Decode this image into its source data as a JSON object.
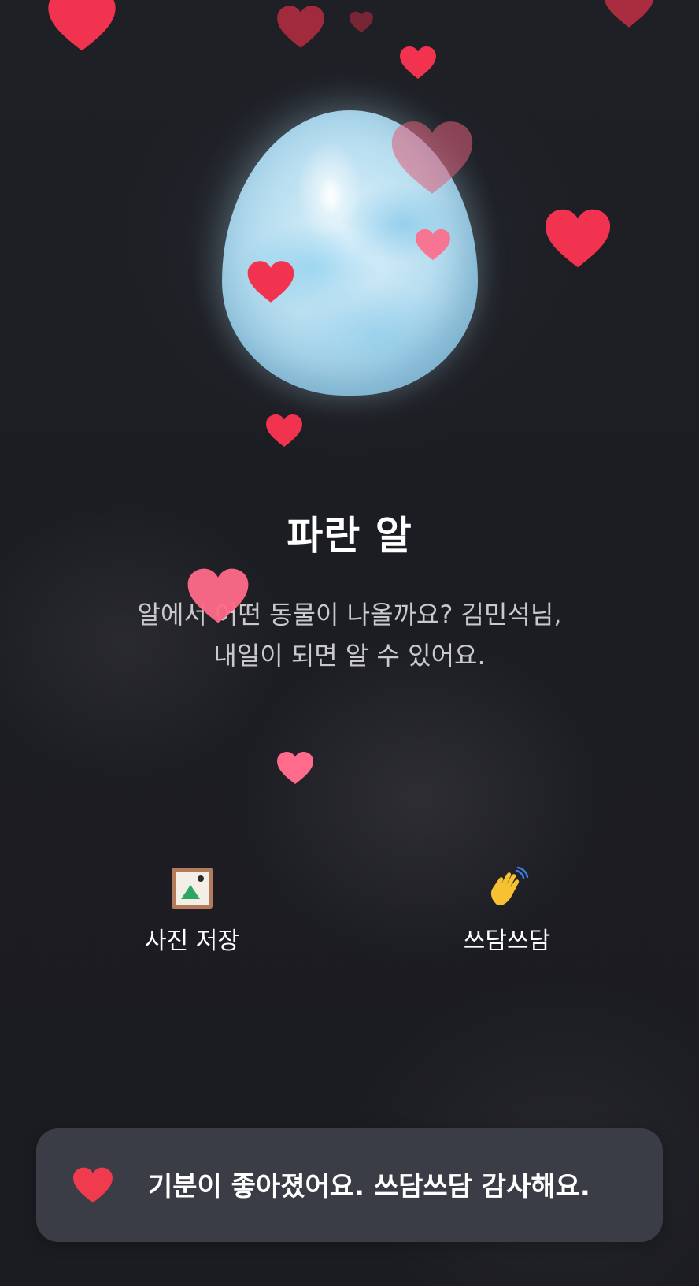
{
  "egg": {
    "name": "파란 알",
    "message_line1": "알에서 어떤 동물이 나올까요? 김민석님,",
    "message_line2": "내일이 되면 알 수 있어요."
  },
  "actions": {
    "save_photo": {
      "label": "사진 저장",
      "icon": "picture-frame-icon"
    },
    "pat": {
      "label": "쓰담쓰담",
      "icon": "waving-hand-icon"
    }
  },
  "toast": {
    "icon": "heart-icon",
    "message": "기분이 좋아졌어요. 쓰담쓰담 감사해요."
  },
  "colors": {
    "background": "#1c1d23",
    "heart_red": "#f2334f",
    "heart_pink": "#ff6b8a",
    "toast_background": "#3a3d45"
  }
}
